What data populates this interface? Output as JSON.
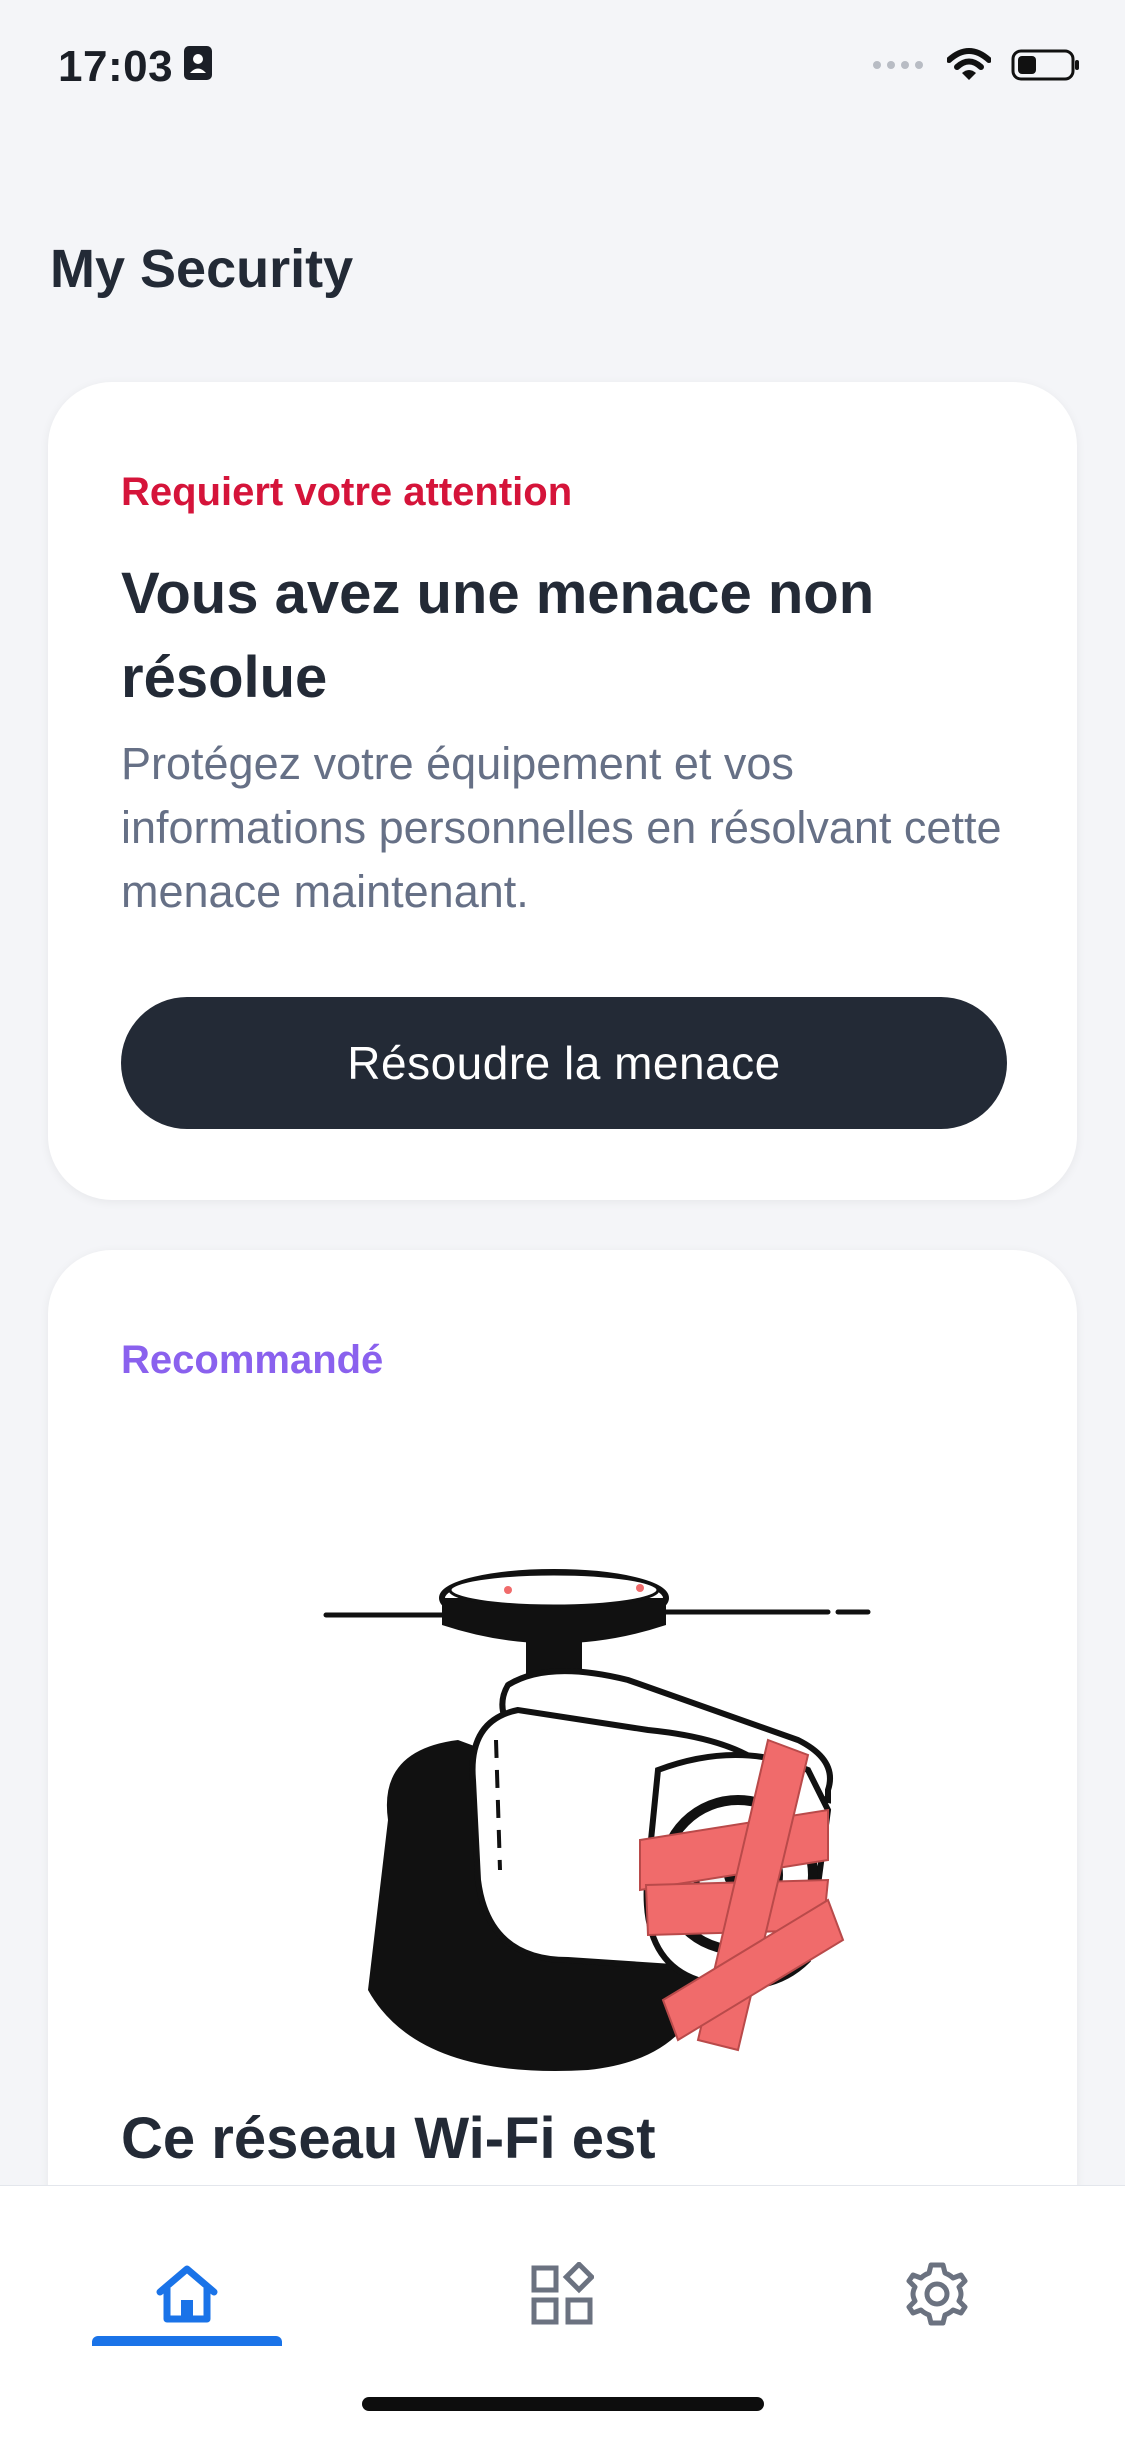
{
  "status_bar": {
    "time": "17:03"
  },
  "page": {
    "title": "My Security"
  },
  "threat_card": {
    "eyebrow": "Requiert votre attention",
    "title": "Vous avez une menace non résolue",
    "body": "Protégez votre équipement et vos informations personnelles en résolvant cette menace maintenant.",
    "button_label": "Résoudre la menace"
  },
  "recommended_card": {
    "eyebrow": "Recommandé",
    "title": "Ce réseau Wi-Fi est"
  },
  "tabs": [
    {
      "icon": "home-icon",
      "active": true
    },
    {
      "icon": "apps-icon",
      "active": false
    },
    {
      "icon": "gear-icon",
      "active": false
    }
  ],
  "colors": {
    "attention_red": "#d5143a",
    "recommended_purple": "#8a61ee",
    "primary_dark": "#232a36",
    "active_tab_blue": "#1a73e8",
    "tape_red": "#f06b6b"
  }
}
